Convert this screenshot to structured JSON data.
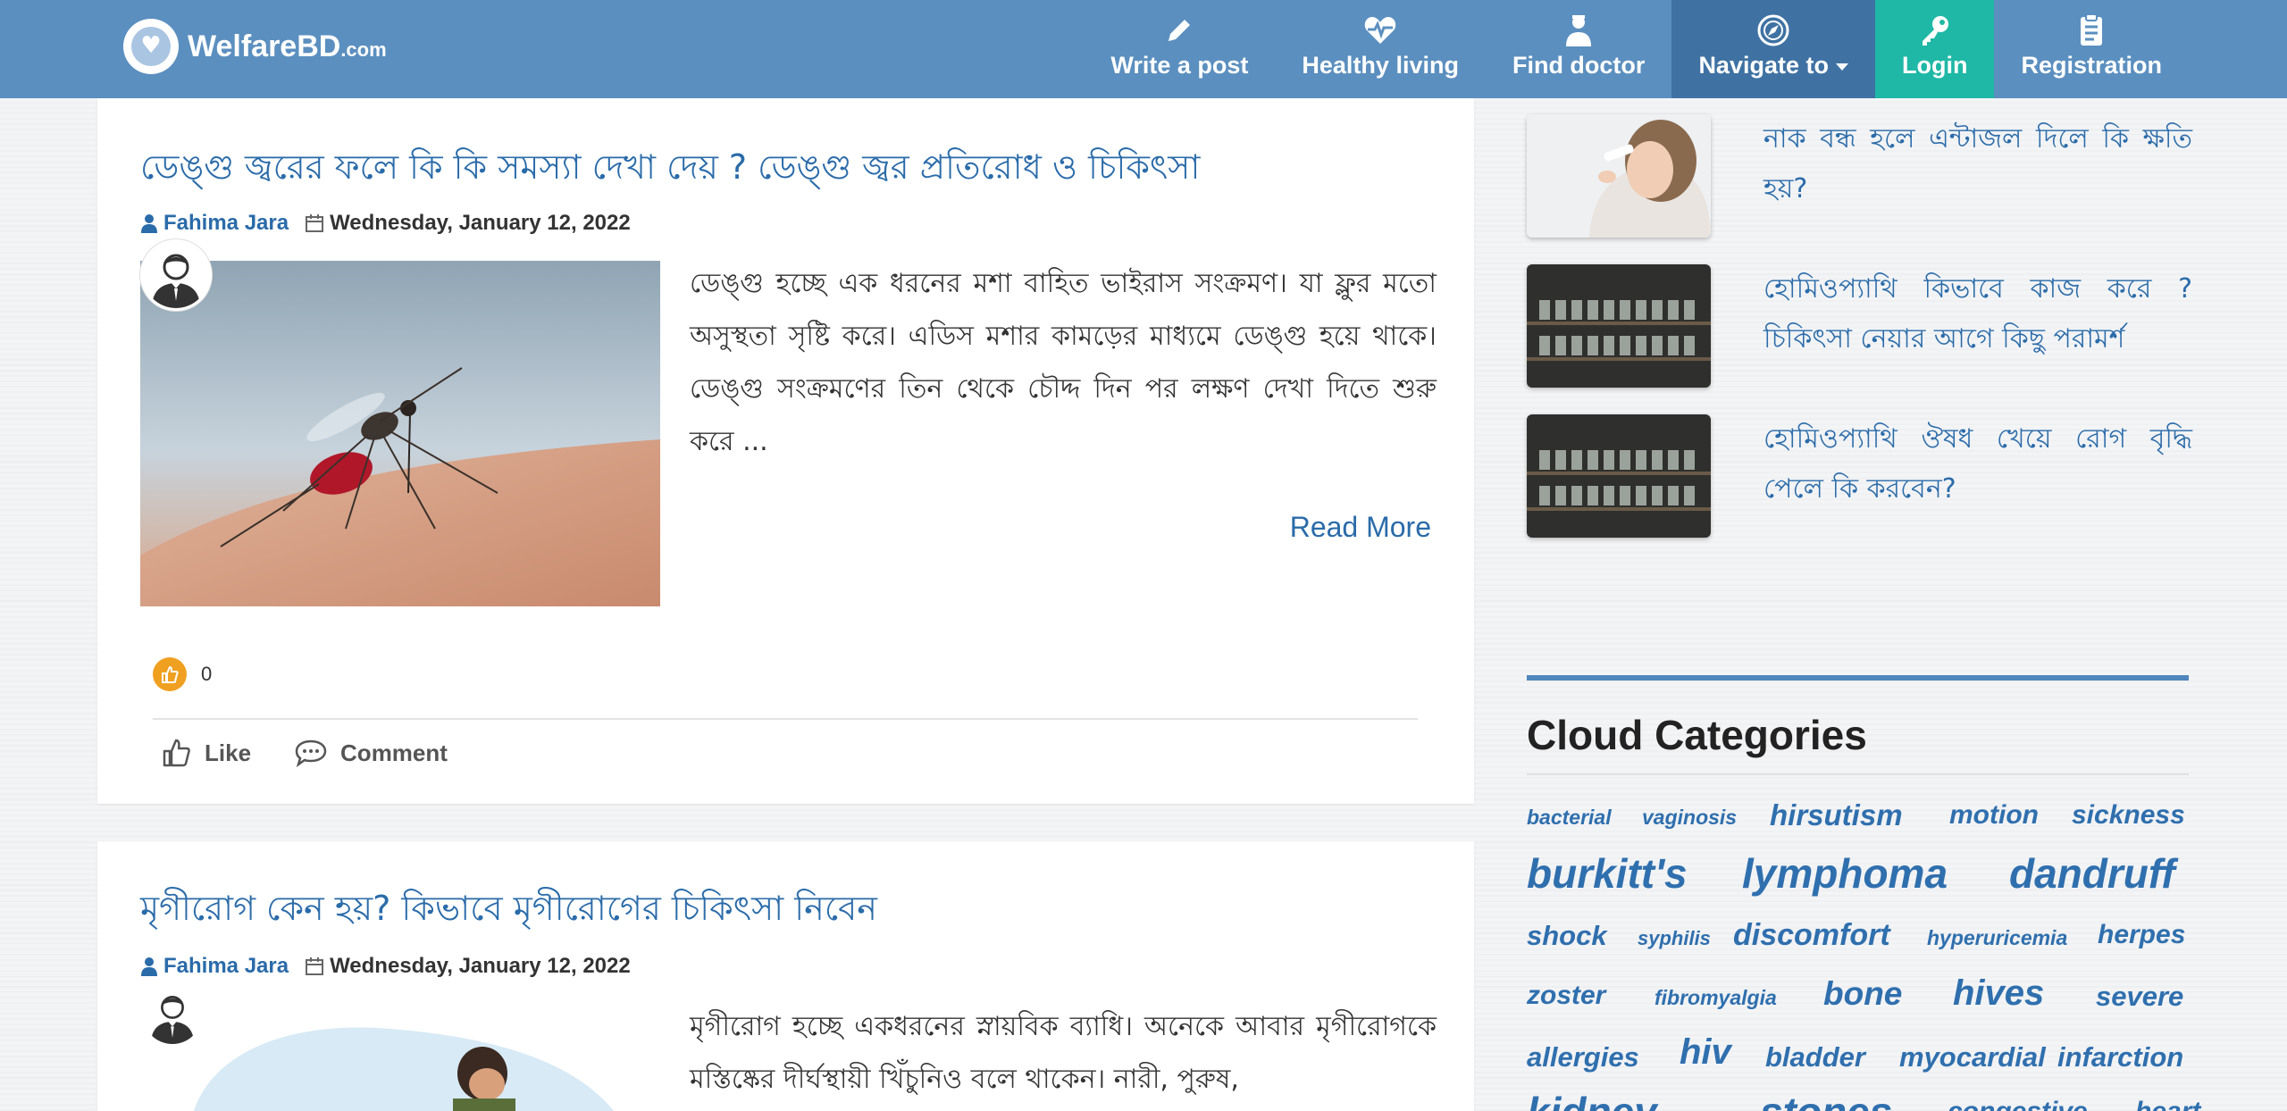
{
  "brand": {
    "name": "WelfareBD",
    "suffix": ".com"
  },
  "nav": [
    {
      "label": "Write a post",
      "icon": "pencil-icon"
    },
    {
      "label": "Healthy living",
      "icon": "heart-pulse-icon"
    },
    {
      "label": "Find doctor",
      "icon": "doctor-icon"
    },
    {
      "label": "Navigate to",
      "icon": "compass-icon"
    },
    {
      "label": "Login",
      "icon": "key-icon"
    },
    {
      "label": "Registration",
      "icon": "clipboard-icon"
    }
  ],
  "posts": [
    {
      "title": "ডেঙ্গু জ্বরের ফলে কি কি সমস্যা দেখা দেয় ? ডেঙ্গু জ্বর প্রতিরোধ ও চিকিৎসা",
      "author": "Fahima Jara",
      "date": "Wednesday, January 12, 2022",
      "excerpt": "ডেঙ্গু হচ্ছে এক ধরনের মশা বাহিত ভাইরাস সংক্রমণ। যা ফ্লুর মতো অসুস্থতা সৃষ্টি করে। এডিস মশার কামড়ের মাধ্যমে ডেঙ্গু হয়ে থাকে। ডেঙ্গু সংক্রমণের তিন থেকে চৌদ্দ দিন পর লক্ষণ দেখা দিতে শুরু করে ...",
      "read_more": "Read More",
      "reaction_count": "0",
      "like_label": "Like",
      "comment_label": "Comment"
    },
    {
      "title": "মৃগীরোগ কেন হয়? কিভাবে মৃগীরোগের চিকিৎসা নিবেন",
      "author": "Fahima Jara",
      "date": "Wednesday, January 12, 2022",
      "excerpt": "মৃগীরোগ হচ্ছে একধরনের স্নায়বিক ব্যাধি। অনেকে আবার মৃগীরোগকে মস্তিষ্কের দীর্ঘস্থায়ী খিঁচুনিও বলে থাকেন। নারী, পুরুষ,"
    }
  ],
  "sidebar": {
    "related": [
      {
        "title": "নাক বন্ধ হলে এন্টাজল দিলে কি ক্ষতি হয়?"
      },
      {
        "title": "হোমিওপ্যাথি কিভাবে কাজ করে ? চিকিৎসা নেয়ার আগে কিছু পরামর্শ"
      },
      {
        "title": "হোমিওপ্যাথি ঔষধ খেয়ে রোগ বৃদ্ধি পেলে কি করবেন?"
      }
    ],
    "cloud_title": "Cloud Categories",
    "cloud": [
      "bacterial",
      "vaginosis",
      "hirsutism",
      "motion",
      "sickness",
      "burkitt's",
      "lymphoma",
      "dandruff",
      "shock",
      "syphilis",
      "discomfort",
      "hyperuricemia",
      "herpes",
      "zoster",
      "fibromyalgia",
      "bone",
      "hives",
      "severe",
      "allergies",
      "hiv",
      "bladder",
      "myocardial",
      "infarction",
      "kidney",
      "stones",
      "congestive",
      "heart"
    ]
  }
}
